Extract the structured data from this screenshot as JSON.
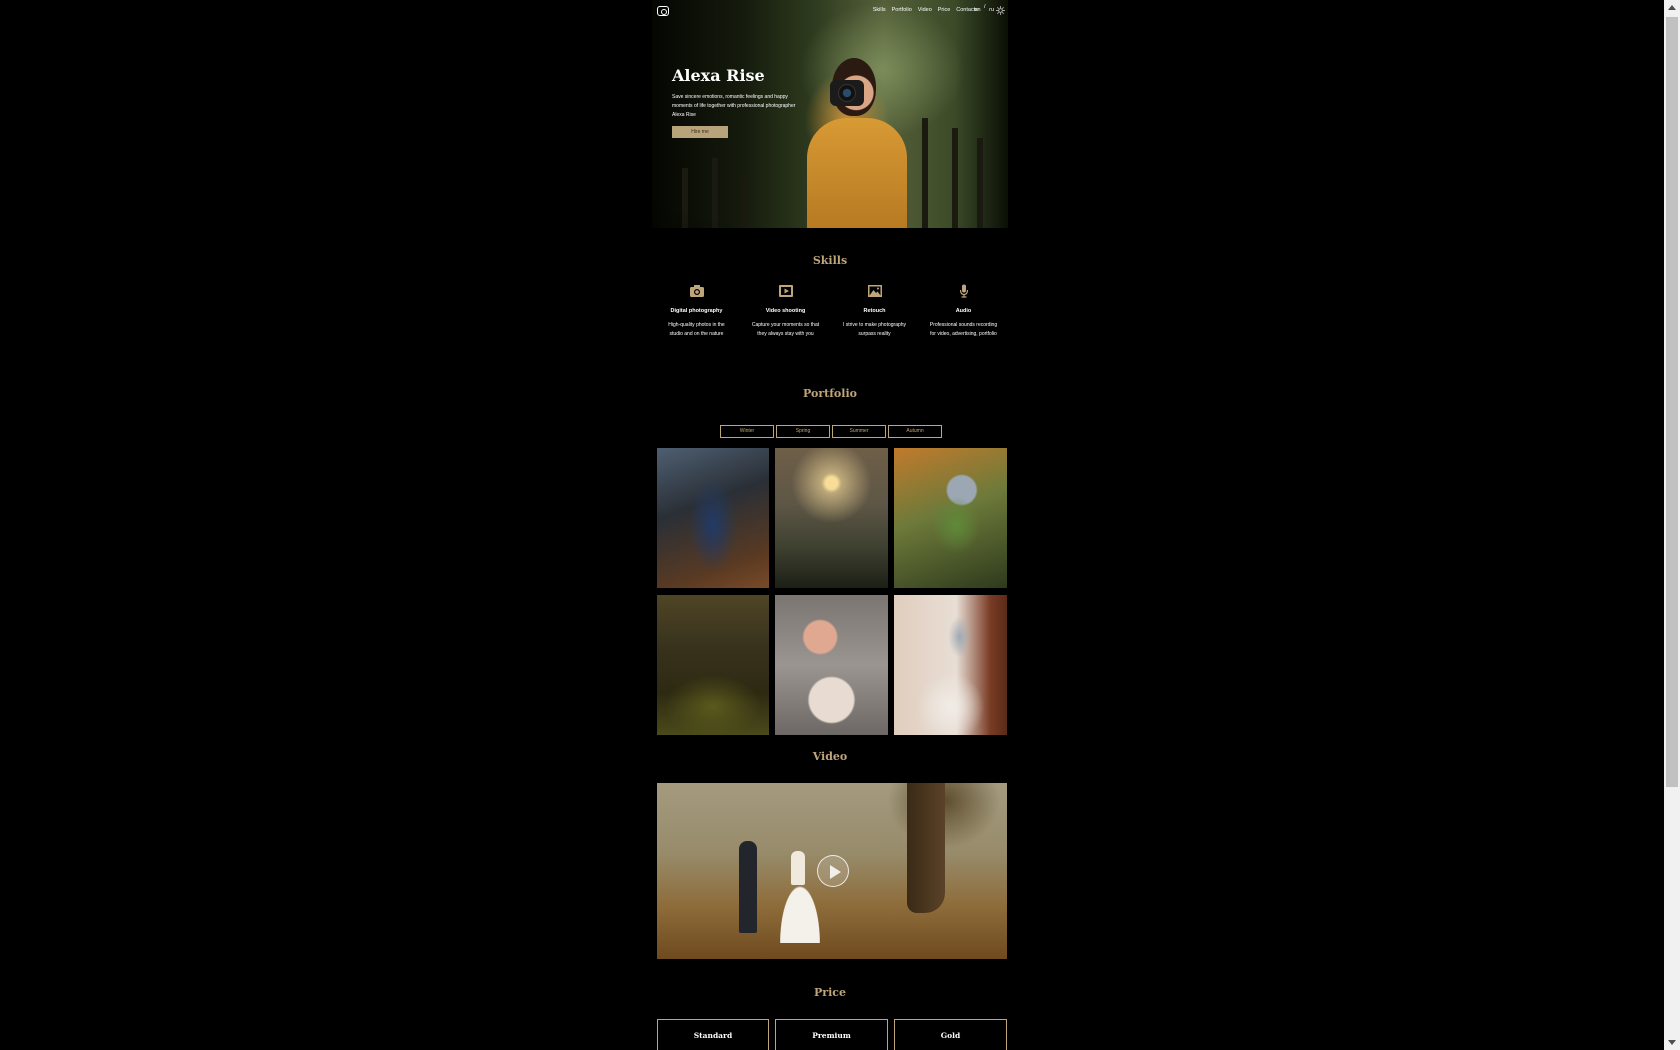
{
  "nav": {
    "links": [
      "Skills",
      "Portfolio",
      "Video",
      "Price",
      "Contacts"
    ],
    "lang_en": "en",
    "lang_sep": "/",
    "lang_ru": "ru",
    "logo_icon": "camera-logo-icon",
    "theme_icon": "sun-icon"
  },
  "hero": {
    "title": "Alexa Rise",
    "text": "Save sincere emotions, romantic feelings and happy moments of life together with professional photographer Alexa Rise",
    "button": "Hire me"
  },
  "skills": {
    "title": "Skills",
    "items": [
      {
        "icon": "camera-icon",
        "name": "Digital photography",
        "desc": "High-quality photos in the studio and on the nature"
      },
      {
        "icon": "video-icon",
        "name": "Video shooting",
        "desc": "Capture your moments so that they always stay with you"
      },
      {
        "icon": "image-icon",
        "name": "Retouch",
        "desc": "I strive to make photography surpass reality"
      },
      {
        "icon": "microphone-icon",
        "name": "Audio",
        "desc": "Professional sounds recording for video, advertising, portfolio"
      }
    ]
  },
  "portfolio": {
    "title": "Portfolio",
    "tabs": [
      "Winter",
      "Spring",
      "Summer",
      "Autumn"
    ]
  },
  "video": {
    "title": "Video",
    "play_icon": "play-icon"
  },
  "price": {
    "title": "Price",
    "cards": [
      "Standard",
      "Premium",
      "Gold"
    ]
  },
  "colors": {
    "accent": "#bfa57a",
    "background": "#000000",
    "button_bg": "#b9a37a"
  }
}
